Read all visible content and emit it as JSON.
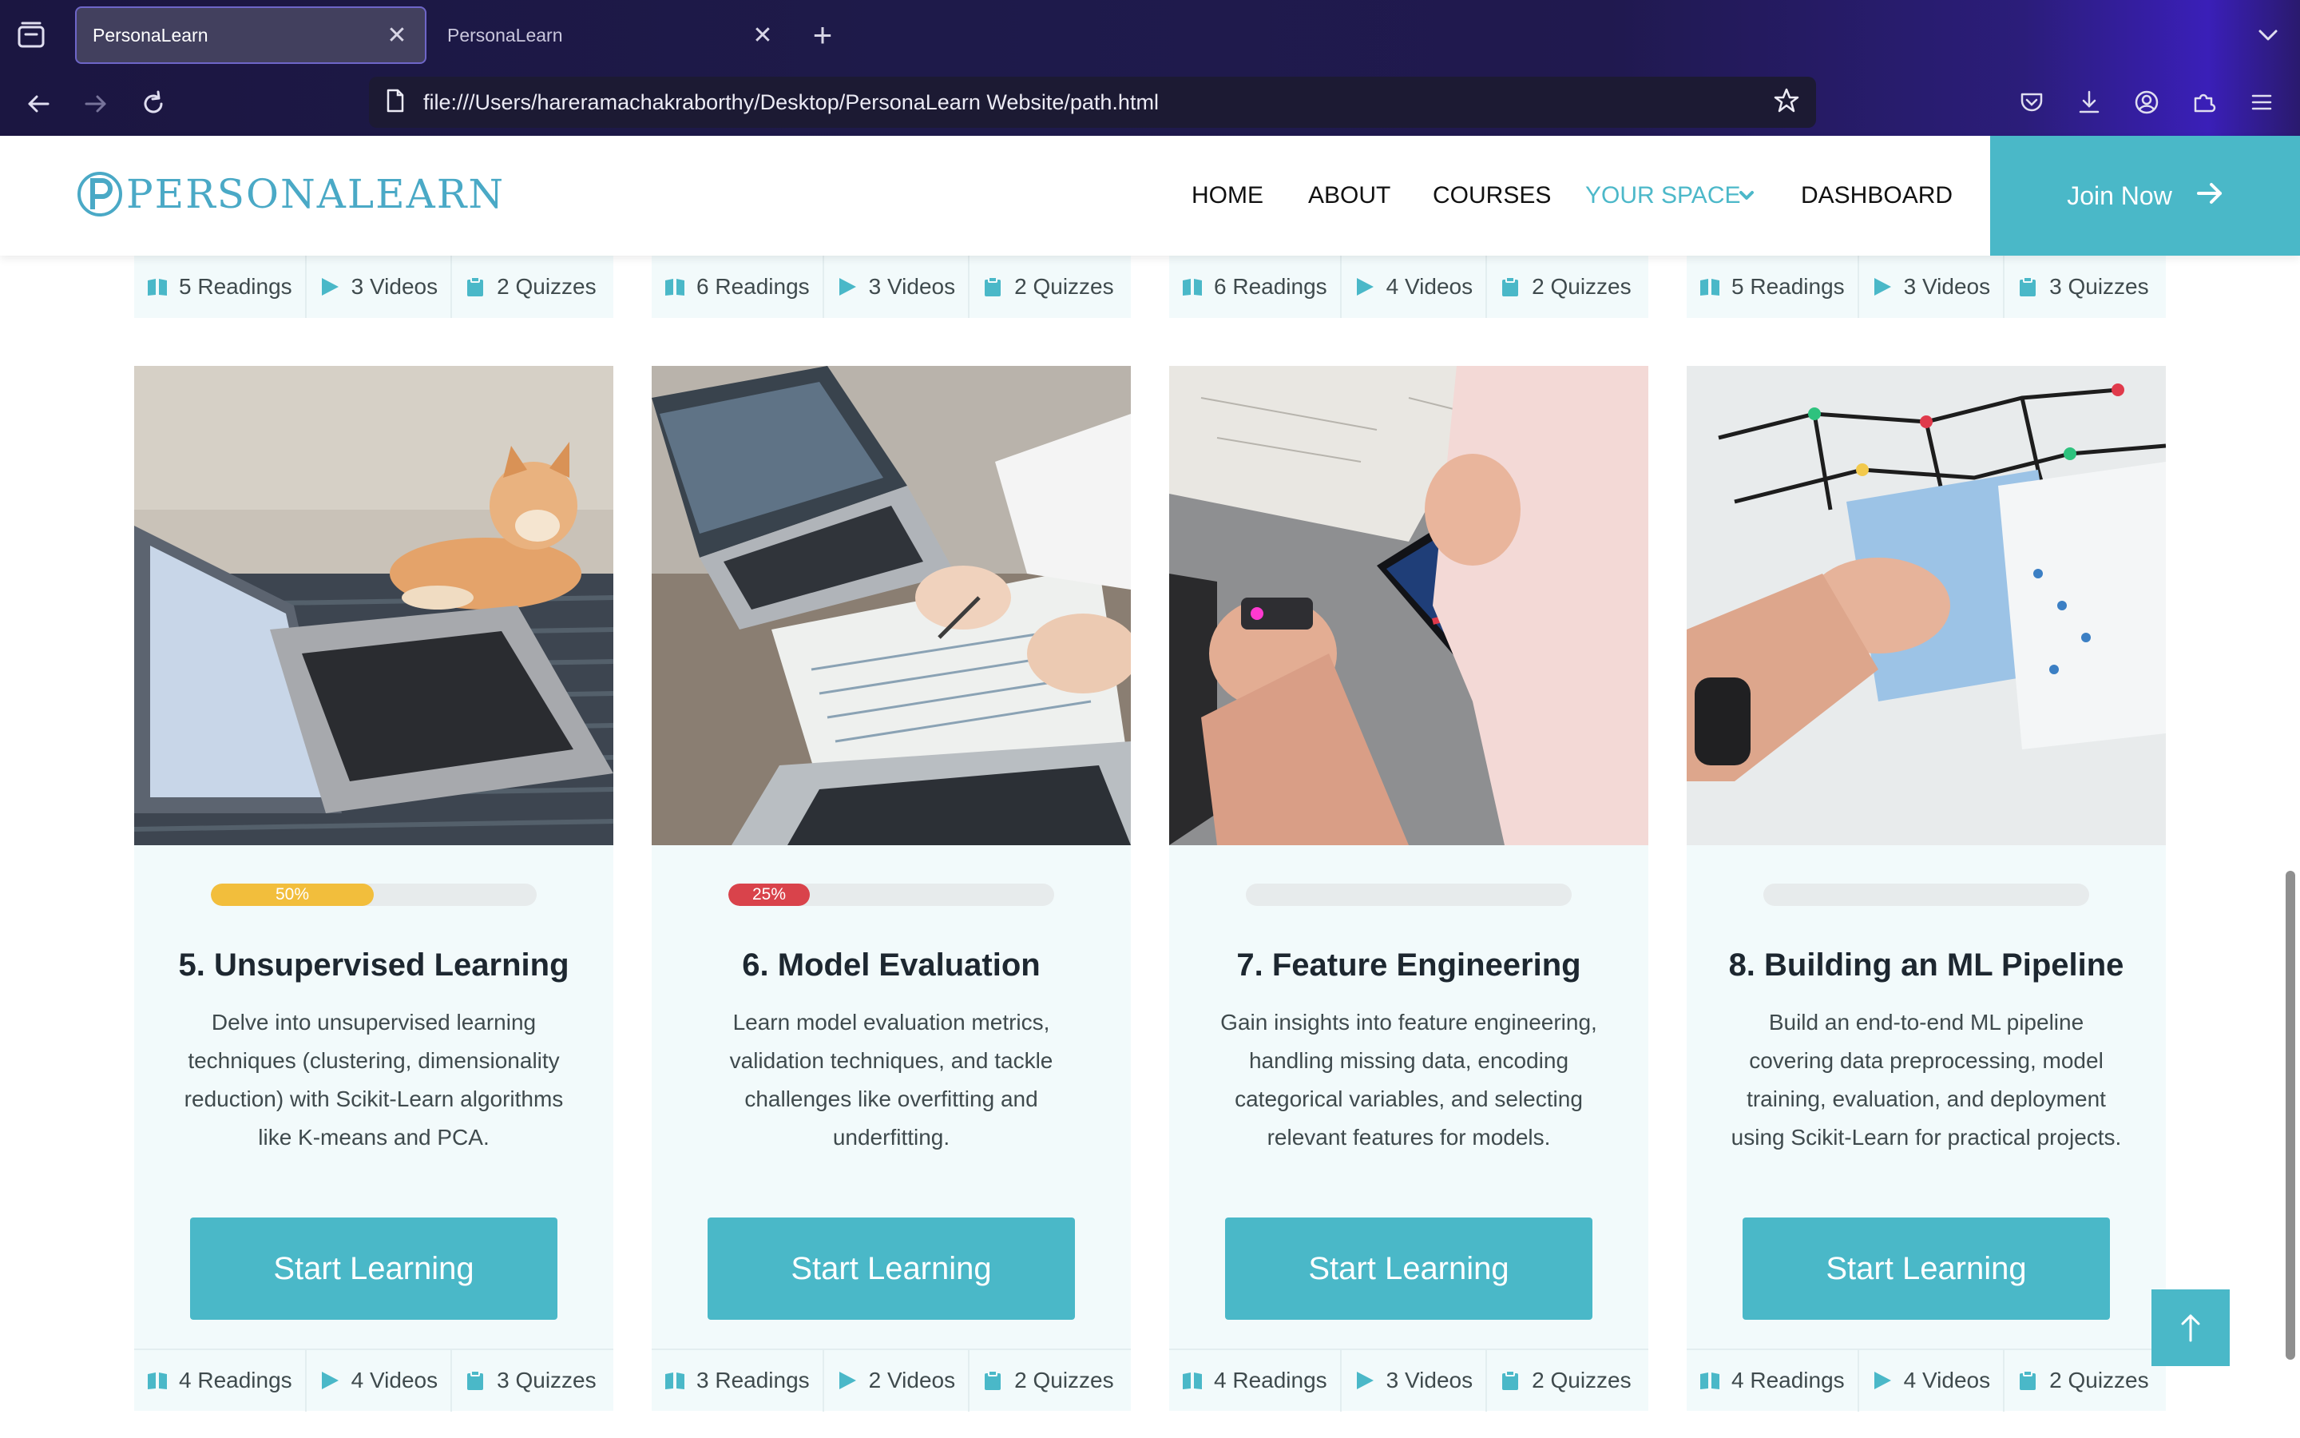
{
  "browser": {
    "tabs": [
      {
        "title": "PersonaLearn",
        "active": true
      },
      {
        "title": "PersonaLearn",
        "active": false
      }
    ],
    "url": "file:///Users/hareramachakraborthy/Desktop/PersonaLearn Website/path.html"
  },
  "header": {
    "logo_text": "PERSONALEARN",
    "nav": [
      {
        "label": "HOME"
      },
      {
        "label": "ABOUT"
      },
      {
        "label": "COURSES"
      },
      {
        "label": "YOUR SPACE"
      },
      {
        "label": "DASHBOARD"
      }
    ],
    "join_label": "Join Now",
    "accent_color": "#4ab8c8"
  },
  "top_stats": [
    {
      "readings": "5 Readings",
      "videos": "3 Videos",
      "quizzes": "2 Quizzes"
    },
    {
      "readings": "6 Readings",
      "videos": "3 Videos",
      "quizzes": "2 Quizzes"
    },
    {
      "readings": "6 Readings",
      "videos": "4 Videos",
      "quizzes": "2 Quizzes"
    },
    {
      "readings": "5 Readings",
      "videos": "3 Videos",
      "quizzes": "3 Quizzes"
    }
  ],
  "cards": [
    {
      "progress_label": "50%",
      "progress": 0.5,
      "progress_color": "#f2be3c",
      "title": "5. Unsupervised Learning",
      "desc": "Delve into unsupervised learning techniques (clustering, dimensionality reduction) with Scikit-Learn algorithms like K-means and PCA.",
      "button": "Start Learning",
      "readings": "4 Readings",
      "videos": "4 Videos",
      "quizzes": "3 Quizzes"
    },
    {
      "progress_label": "25%",
      "progress": 0.25,
      "progress_color": "#d9434b",
      "title": "6. Model Evaluation",
      "desc": "Learn model evaluation metrics, validation techniques, and tackle challenges like overfitting and underfitting.",
      "button": "Start Learning",
      "readings": "3 Readings",
      "videos": "2 Videos",
      "quizzes": "2 Quizzes"
    },
    {
      "progress_label": "",
      "progress": 0,
      "progress_color": "#4ab8c8",
      "title": "7. Feature Engineering",
      "desc": "Gain insights into feature engineering, handling missing data, encoding categorical variables, and selecting relevant features for models.",
      "button": "Start Learning",
      "readings": "4 Readings",
      "videos": "3 Videos",
      "quizzes": "2 Quizzes"
    },
    {
      "progress_label": "",
      "progress": 0,
      "progress_color": "#4ab8c8",
      "title": "8. Building an ML Pipeline",
      "desc": "Build an end-to-end ML pipeline covering data preprocessing, model training, evaluation, and deployment using Scikit-Learn for practical projects.",
      "button": "Start Learning",
      "readings": "4 Readings",
      "videos": "4 Videos",
      "quizzes": "2 Quizzes"
    }
  ]
}
